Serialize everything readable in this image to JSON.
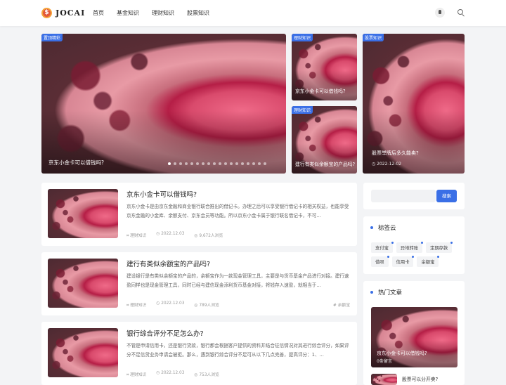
{
  "header": {
    "logo_symbol": "$",
    "logo_text": "JOCAI",
    "nav": [
      "首页",
      "基金知识",
      "理财知识",
      "股票知识"
    ]
  },
  "hero": {
    "main": {
      "tag": "置顶精彩",
      "title": "京东小金卡可以借钱吗?",
      "slide_count": 18,
      "active_slide": 1
    },
    "mid_top": {
      "tag": "理财知识",
      "title": "京东小金卡可以借钱吗?"
    },
    "mid_bottom": {
      "tag": "理财知识",
      "title": "建行有类似余额宝的产品吗?"
    },
    "right": {
      "tag": "股票知识",
      "title": "股票举牌后多久能卖?",
      "date": "2022-12-02"
    }
  },
  "posts": [
    {
      "title": "京东小金卡可以借钱吗?",
      "excerpt": "京东小金卡是由京东金融和商业银行联合推出的借记卡。办理之后可以享受银行借记卡的相关权益，也能享受京东金融的小金库、余额支付、京东会员等功能。所以京东小金卡属于银行联名借记卡，不可...",
      "category": "理财知识",
      "date": "2022.12.03",
      "views": "9,672人浏览",
      "tag": ""
    },
    {
      "title": "建行有类似余额宝的产品吗?",
      "excerpt": "建设银行是有类似余额宝的产品的，余额宝作为一款现金管理工具，主要是与货币基金产品进行对接。建行速盈同样也是现金管理工具，同时已经与建信现金添利货币基金对接，将钱存入速盈，就相当于...",
      "category": "理财知识",
      "date": "2022.12.03",
      "views": "789人浏览",
      "tag": "# 余额宝"
    },
    {
      "title": "银行综合评分不足怎么办?",
      "excerpt": "不管是申请信用卡，还是银行贷款，银行都会根据客户提供的资料并结合征信情况对其进行综合评分，如果评分不足信贷业务申请会被拒。那么，遇到银行综合评分不足可从以下几点完善，提高评分：1、...",
      "category": "理财知识",
      "date": "2022.12.03",
      "views": "753人浏览",
      "tag": ""
    }
  ],
  "sidebar": {
    "search_button": "搜索",
    "search_placeholder": "",
    "tags_title": "标签云",
    "tags": [
      "支付宝",
      "异地转账",
      "定期存款",
      "借呗",
      "信用卡",
      "余额宝"
    ],
    "hot_title": "热门文章",
    "hot_item": {
      "title": "京东小金卡可以借钱吗?",
      "comments": "0条留言"
    },
    "hot_next_title": "股票可以分开卖?"
  },
  "colors": {
    "accent": "#3a6fe6",
    "logo": "#e3593b"
  }
}
